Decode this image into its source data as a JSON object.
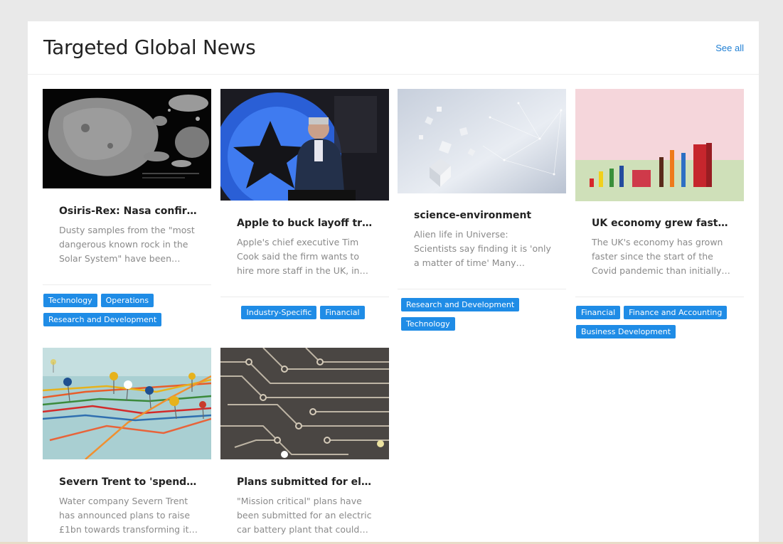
{
  "section": {
    "title": "Targeted Global News",
    "see_all": "See all"
  },
  "articles": [
    {
      "title": "Osiris-Rex: Nasa confirms r...",
      "description": "Dusty samples from the \"most dangerous known rock in the Solar System\" have been brough...",
      "tags": [
        "Technology",
        "Operations",
        "Research and Development"
      ],
      "image": "asteroid-photo"
    },
    {
      "title": "Apple to buck layoff trend ...",
      "description": "Apple's chief executive Tim Cook said the firm wants to hire more staff in the UK, in contrast to...",
      "tags": [
        "Industry-Specific",
        "Financial"
      ],
      "image": "speaker-photo"
    },
    {
      "title": "science-environment",
      "description": "Alien life in Universe: Scientists say finding it is 'only a matter of time' Many astronomers are no longer...",
      "tags": [
        "Research and Development",
        "Technology"
      ],
      "image": "cubes-network-photo"
    },
    {
      "title": "UK economy grew faster th...",
      "description": "The UK's economy has grown faster since the start of the Covid pandemic than initially thought,...",
      "tags": [
        "Financial",
        "Finance and Accounting",
        "Business Development"
      ],
      "image": "bar-blocks-photo"
    },
    {
      "title": "Severn Trent to 'spend billi...",
      "description": "Water company Severn Trent has announced plans to raise £1bn towards transforming its networ...",
      "tags": [],
      "image": "map-pins-photo"
    },
    {
      "title": "Plans submitted for electric...",
      "description": "\"Mission critical\" plans have been submitted for an electric car battery plant that could create u...",
      "tags": [],
      "image": "circuit-board-photo"
    }
  ],
  "colors": {
    "accent": "#1f8ce6",
    "link": "#1f7fd4",
    "page_bg": "#e9e9e9"
  }
}
